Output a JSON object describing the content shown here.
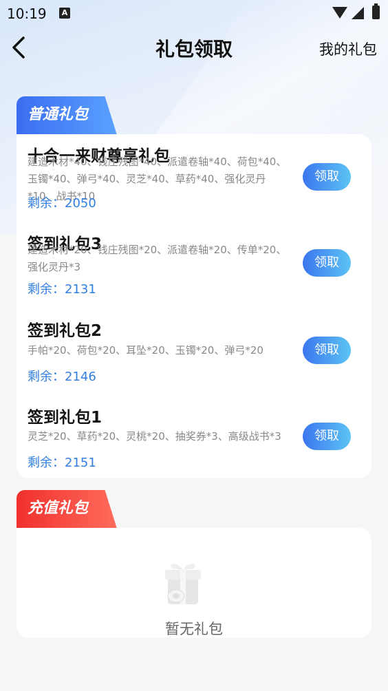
{
  "status_bar": {
    "time": "10:19",
    "notif_icon": "A"
  },
  "header": {
    "title": "礼包领取",
    "my_gifts": "我的礼包"
  },
  "sections": {
    "normal": {
      "tab_label": "普通礼包",
      "items": [
        {
          "name": "十合一来财尊享礼包",
          "desc": "建造木材*40、钱庄残图*40、派遣卷轴*40、荷包*40、玉镯*40、弹弓*40、灵芝*40、草药*40、强化灵丹*10、战书*10",
          "remaining_label": "剩余：",
          "remaining": "2050",
          "claim_label": "领取"
        },
        {
          "name": "签到礼包3",
          "desc": "建造木材*20、钱庄残图*20、派遣卷轴*20、传单*20、强化灵丹*3",
          "remaining_label": "剩余：",
          "remaining": "2131",
          "claim_label": "领取"
        },
        {
          "name": "签到礼包2",
          "desc": "手帕*20、荷包*20、耳坠*20、玉镯*20、弹弓*20",
          "remaining_label": "剩余：",
          "remaining": "2146",
          "claim_label": "领取"
        },
        {
          "name": "签到礼包1",
          "desc": "灵芝*20、草药*20、灵桃*20、抽奖券*3、高级战书*3",
          "remaining_label": "剩余：",
          "remaining": "2151",
          "claim_label": "领取"
        }
      ]
    },
    "recharge": {
      "tab_label": "充值礼包",
      "empty_text": "暂无礼包",
      "empty_icon": "gift-box-icon"
    }
  },
  "colors": {
    "accent_blue": "#2f7ee0",
    "tab_red": "#f0302e",
    "tab_blue": "#3a6df0"
  }
}
